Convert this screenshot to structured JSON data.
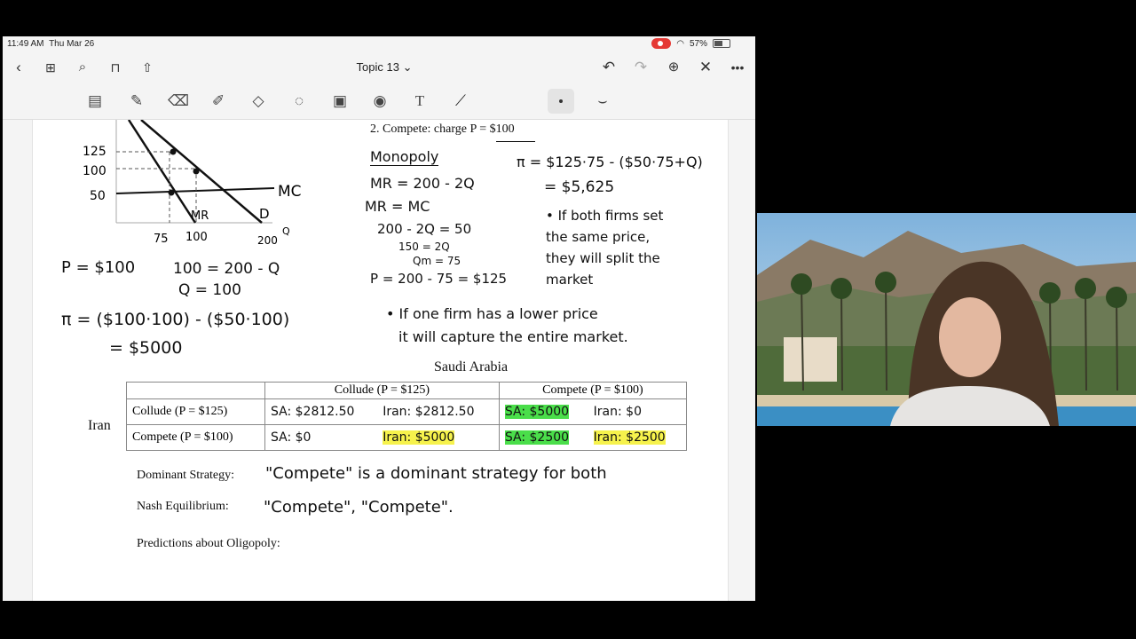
{
  "status": {
    "time": "11:49 AM",
    "date": "Thu Mar 26",
    "battery": "57%"
  },
  "nav": {
    "title": "Topic 13 ⌄"
  },
  "notes": {
    "rules": {
      "item2": "2.   Compete: charge P = $100"
    },
    "graph": {
      "y_labels": [
        "125",
        "100",
        "50"
      ],
      "x_labels": [
        "75",
        "100",
        "200"
      ],
      "curve_labels": {
        "mc": "MC",
        "mr": "MR",
        "d": "D",
        "q": "Q"
      }
    },
    "left_work": {
      "line1": "P = $100",
      "line2": "100 = 200 - Q",
      "line3": "Q = 100",
      "line4": "π = ($100·100) - ($50·100)",
      "line5": "= $5000"
    },
    "monopoly": {
      "heading": "Monopoly",
      "line1": "MR = 200 - 2Q",
      "line2": "MR = MC",
      "line3": "200 - 2Q = 50",
      "line4": "150 = 2Q",
      "line5": "Qm = 75",
      "line6": "P = 200 - 75 = $125"
    },
    "profit": {
      "line1": "π = $125·75 - ($50·75+Q)",
      "line2": "= $5,625"
    },
    "bullet1": [
      "• If both firms set",
      "the same price,",
      "they will split the",
      "market"
    ],
    "bullet2": [
      "• If one firm has a lower price",
      "it will capture the entire market."
    ]
  },
  "payoff": {
    "col_player": "Saudi Arabia",
    "row_player": "Iran",
    "col_headers": [
      "Collude (P = $125)",
      "Compete (P = $100)"
    ],
    "row_headers": [
      "Collude (P = $125)",
      "Compete (P = $100)"
    ],
    "cells": [
      [
        "SA: $2812.50",
        "Iran: $2812.50",
        "SA: $5000",
        "Iran: $0"
      ],
      [
        "SA: $0",
        "Iran: $5000",
        "SA: $2500",
        "Iran: $2500"
      ]
    ]
  },
  "bottom": {
    "dominant_label": "Dominant Strategy:",
    "dominant_value": "\"Compete\" is a dominant strategy for both",
    "nash_label": "Nash Equilibrium:",
    "nash_value": "\"Compete\", \"Compete\".",
    "predictions_label": "Predictions about Oligopoly:"
  },
  "colors": {
    "green_highlight": "#4ade4a",
    "yellow_highlight": "#f6f24c",
    "record": "#e53935"
  }
}
